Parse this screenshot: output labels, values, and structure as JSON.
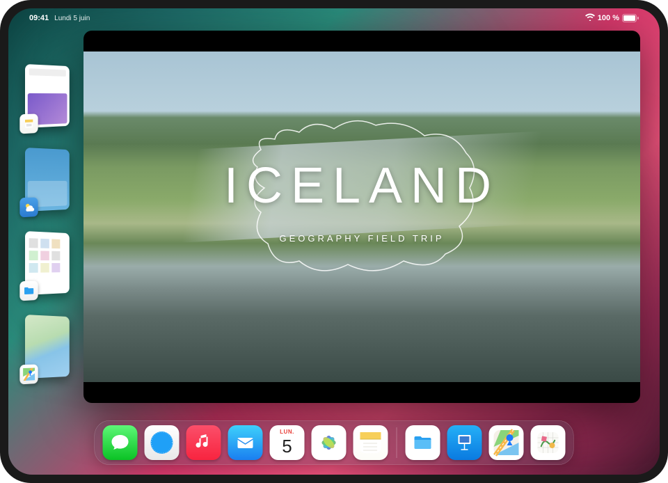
{
  "status": {
    "time": "09:41",
    "date": "Lundi 5 juin",
    "battery": "100 %"
  },
  "main_slide": {
    "title": "ICELAND",
    "subtitle": "GEOGRAPHY FIELD TRIP"
  },
  "stage_items": [
    {
      "app": "Notes",
      "name": "notes"
    },
    {
      "app": "Weather",
      "name": "weather"
    },
    {
      "app": "Files",
      "name": "files"
    },
    {
      "app": "Maps",
      "name": "maps"
    }
  ],
  "calendar": {
    "month_abbrev": "LUN.",
    "day": "5"
  },
  "dock": [
    {
      "name": "messages",
      "label": "Messages"
    },
    {
      "name": "safari",
      "label": "Safari"
    },
    {
      "name": "music",
      "label": "Music"
    },
    {
      "name": "mail",
      "label": "Mail"
    },
    {
      "name": "calendar",
      "label": "Calendar"
    },
    {
      "name": "photos",
      "label": "Photos"
    },
    {
      "name": "notes",
      "label": "Notes"
    },
    {
      "name": "sep"
    },
    {
      "name": "files",
      "label": "Files"
    },
    {
      "name": "keynote",
      "label": "Keynote"
    },
    {
      "name": "maps",
      "label": "Maps"
    },
    {
      "name": "freeform",
      "label": "Freeform"
    }
  ]
}
